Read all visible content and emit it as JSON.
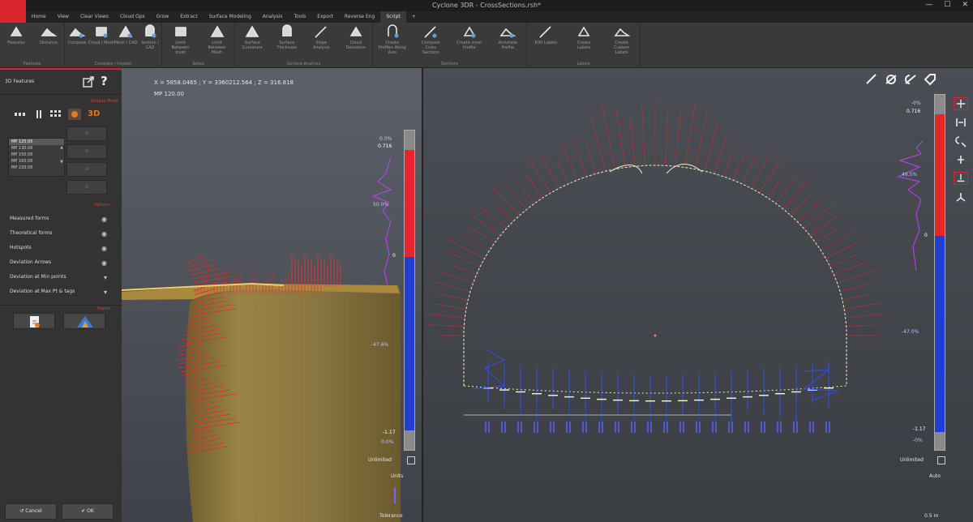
{
  "window": {
    "title": "Cyclone 3DR - CrossSections.rsh*",
    "controls": [
      "—",
      "☐",
      "✕"
    ]
  },
  "ribbon_tabs": [
    {
      "label": "Home",
      "active": false
    },
    {
      "label": "View",
      "active": false
    },
    {
      "label": "Clear Views",
      "active": false
    },
    {
      "label": "Cloud Ops",
      "active": false
    },
    {
      "label": "Grow",
      "active": false
    },
    {
      "label": "Extract",
      "active": false
    },
    {
      "label": "Surface Modeling",
      "active": false
    },
    {
      "label": "Analysis",
      "active": false
    },
    {
      "label": "Tools",
      "active": false
    },
    {
      "label": "Export",
      "active": false
    },
    {
      "label": "Reverse Eng",
      "active": false
    },
    {
      "label": "Script",
      "active": true
    },
    {
      "label": "+",
      "active": false
    }
  ],
  "ribbon": {
    "groups": [
      {
        "label": "Features",
        "buttons": [
          "Features",
          "Distance"
        ]
      },
      {
        "label": "Compare / Inspect",
        "buttons": [
          "Compare",
          "Cloud / Mesh",
          "Mesh / CAD",
          "Section / CAD"
        ]
      },
      {
        "label": "Setup",
        "buttons": [
          "Limit Between Inset",
          "Limit Between Mesh"
        ]
      },
      {
        "label": "Surface Analysis",
        "buttons": [
          "Surface Curvature",
          "Surface Thickness",
          "Slope Analysis",
          "Cloud Deviation"
        ]
      },
      {
        "label": "Sections",
        "buttons": [
          "Create Profiles Along Axis",
          "Compare Cross Sections",
          "Create Inner Profile",
          "Annotate Profile"
        ]
      },
      {
        "label": "Labels",
        "buttons": [
          "Edit Labels",
          "Create Labels",
          "Create Custom Labels"
        ]
      }
    ]
  },
  "left_panel": {
    "title": "3D Features",
    "help": "?",
    "display_tag": "Display Mode",
    "view_3d_label": "3D",
    "measure_points": [
      "MP 120.00",
      "MP 130.00",
      "MP 150.00",
      "MP 160.00",
      "MP 220.00"
    ],
    "selected_point": "MP 120.00",
    "square_buttons": [
      "⊕",
      "⊕",
      "⊕",
      "⊕"
    ],
    "options_tag": "Options",
    "options": [
      {
        "label": "Measured forms",
        "icon": "eye-icon"
      },
      {
        "label": "Theoretical forms",
        "icon": "eye-icon"
      },
      {
        "label": "Hotspots",
        "icon": "eye-icon"
      },
      {
        "label": "Deviation Arrows",
        "icon": "eye-icon"
      },
      {
        "label": "Deviation at Min points",
        "icon": "pin-icon"
      },
      {
        "label": "Deviation at Max Pt & tags",
        "icon": "pin-icon"
      }
    ],
    "report_tag": "Report",
    "cancel_label": "Cancel",
    "ok_label": "OK"
  },
  "left_view": {
    "coords": "X = 5858.0465 ; Y = 3360212.564 ; Z = 316.818",
    "mp_readout": "MP 120.00",
    "scale_top_pct": "0.0%",
    "scale_top_val": "0.716",
    "scale_mid_pct": "50.0%",
    "scale_zero": "0",
    "scale_low_pct": "-47.6%",
    "scale_bottom_val": "-1.17",
    "scale_bottom_pct": "0.0%",
    "unlimited_label": "Unlimited",
    "units_label": "Units",
    "tolerance_label": "Tolerance"
  },
  "right_view": {
    "scale_top_pct": "-0%",
    "scale_top_val": "0.716",
    "scale_mid_pct": "49.5%",
    "scale_zero": "0",
    "scale_low_pct": "-47.0%",
    "scale_bottom_val": "-1.17",
    "scale_bottom_pct": "-0%",
    "unlimited_label": "Unlimited",
    "units_label": "Auto",
    "scale_bar_label": "0.5 m",
    "tool_icons": [
      "ruler-icon",
      "hide-icon",
      "hide-point-icon",
      "label-icon"
    ],
    "side_tools": [
      "move-icon",
      "fit-icon",
      "zoom-icon",
      "center-icon",
      "cut-icon",
      "axis-icon"
    ]
  },
  "colors": {
    "accent": "#d7262d",
    "deviation_positive": "#e8262a",
    "deviation_negative": "#1f3fd0",
    "theoretical_line": "#f0f0c0",
    "histogram": "#c040ff"
  }
}
